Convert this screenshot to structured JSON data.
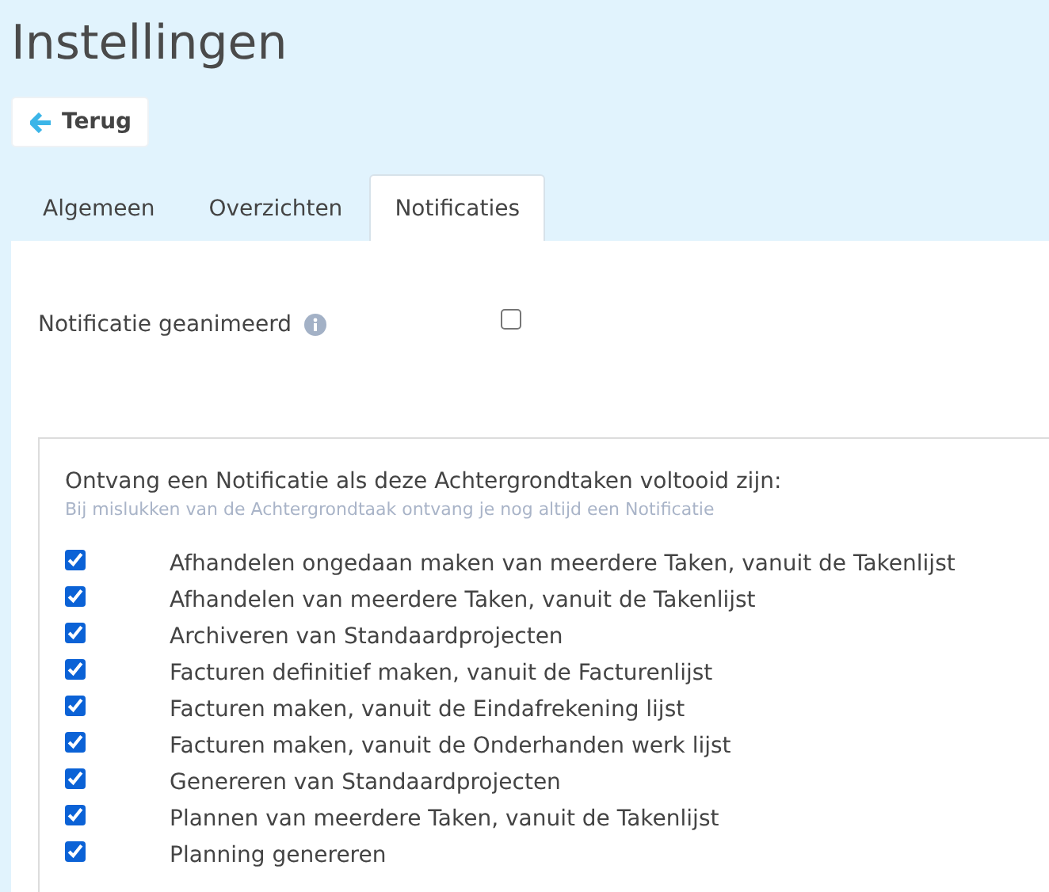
{
  "page_title": "Instellingen",
  "back_button": {
    "label": "Terug"
  },
  "tabs": [
    {
      "label": "Algemeen",
      "selected": false
    },
    {
      "label": "Overzichten",
      "selected": false
    },
    {
      "label": "Notificaties",
      "selected": true
    }
  ],
  "animated_setting": {
    "label": "Notificatie geanimeerd",
    "checked": false
  },
  "task_panel": {
    "heading": "Ontvang een Notificatie als deze Achtergrondtaken voltooid zijn:",
    "note": "Bij mislukken van de Achtergrondtaak ontvang je nog altijd een Notificatie",
    "tasks": [
      {
        "label": "Afhandelen ongedaan maken van meerdere Taken, vanuit de Takenlijst",
        "checked": true
      },
      {
        "label": "Afhandelen van meerdere Taken, vanuit de Takenlijst",
        "checked": true
      },
      {
        "label": "Archiveren van Standaardprojecten",
        "checked": true
      },
      {
        "label": "Facturen definitief maken, vanuit de Facturenlijst",
        "checked": true
      },
      {
        "label": "Facturen maken, vanuit de Eindafrekening lijst",
        "checked": true
      },
      {
        "label": "Facturen maken, vanuit de Onderhanden werk lijst",
        "checked": true
      },
      {
        "label": "Genereren van Standaardprojecten",
        "checked": true
      },
      {
        "label": "Plannen van meerdere Taken, vanuit de Takenlijst",
        "checked": true
      },
      {
        "label": "Planning genereren",
        "checked": true
      }
    ]
  }
}
